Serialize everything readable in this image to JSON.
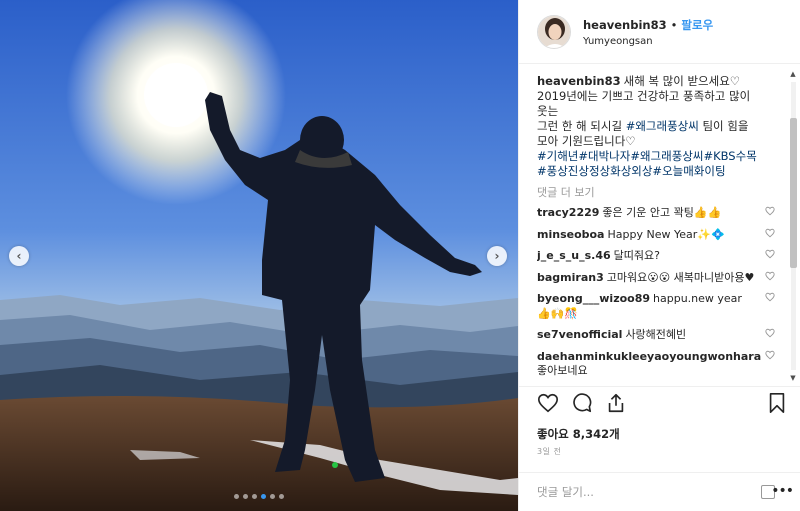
{
  "post": {
    "username": "heavenbin83",
    "separator": "•",
    "follow_label": "팔로우",
    "location": "Yumyeongsan"
  },
  "photo": {
    "prev_icon": "chevron-left-icon",
    "next_icon": "chevron-right-icon",
    "prev_glyph": "‹",
    "next_glyph": "›",
    "page_count": 6,
    "active_page": 3
  },
  "caption": {
    "username": "heavenbin83",
    "lines": [
      "새해 복 많이 받으세요♡",
      "2019년에는 기쁘고 건강하고 풍족하고 많이",
      "웃는",
      "그런 한 해 되시길 "
    ],
    "hashtag1": "#왜그래풍상씨",
    "line4_rest": " 팀이 힘을",
    "line5": "모아 기원드립니다♡",
    "tags_line1": "#기해년#대박나자#왜그래풍상씨#KBS수목",
    "tags_line2": "#풍상진상정상화상외상#오늘매화이팅"
  },
  "more_comments_label": "댓글 더 보기",
  "comments": [
    {
      "username": "tracy2229",
      "text": "좋은 기운 안고 꽉팅👍👍"
    },
    {
      "username": "minseoboa",
      "text": "Happy New Year✨💠"
    },
    {
      "username": "j_e_s_u_s.46",
      "text": "달띠줘요?"
    },
    {
      "username": "bagmiran3",
      "text": "고마워요😮😮 새복마니받아용♥"
    },
    {
      "username": "byeong___wizoo89",
      "text": "happu.new year👍🙌🎊"
    },
    {
      "username": "se7venofficial",
      "text": "사랑해전혜빈"
    },
    {
      "username": "daehanminkukleeyaoyoungwonhara",
      "text": "좋아보네요"
    }
  ],
  "likes": {
    "label": "좋아요",
    "count": "8,342개"
  },
  "time_ago": "3일 전",
  "comment_input": {
    "placeholder": "댓글 달기..."
  },
  "more_options_glyph": "•••",
  "icons": [
    "heart-icon",
    "comment-icon",
    "share-icon",
    "bookmark-icon"
  ],
  "colors": {
    "link_blue": "#3897f0",
    "hashtag": "#003569",
    "muted": "#999999"
  }
}
